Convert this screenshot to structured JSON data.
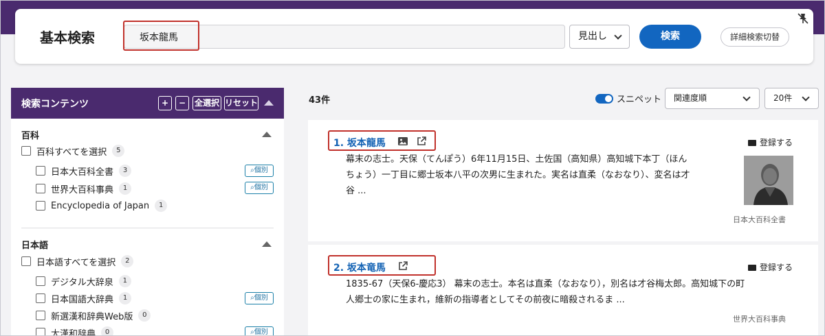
{
  "search": {
    "title": "基本検索",
    "query": "坂本龍馬",
    "scope": "見出し",
    "submit_label": "検索",
    "advanced_label": "詳細検索切替"
  },
  "sidebar": {
    "title": "検索コンテンツ",
    "buttons": {
      "expand": "+",
      "collapse": "−",
      "select_all": "全選択",
      "reset": "リセット"
    },
    "sections": [
      {
        "title": "百科",
        "select_all_label": "百科すべてを選択",
        "select_all_count": "5",
        "items": [
          {
            "label": "日本大百科全書",
            "count": "3",
            "kobetsu": "個別"
          },
          {
            "label": "世界大百科事典",
            "count": "1",
            "kobetsu": "個別"
          },
          {
            "label": "Encyclopedia of Japan",
            "count": "1"
          }
        ]
      },
      {
        "title": "日本語",
        "select_all_label": "日本語すべてを選択",
        "select_all_count": "2",
        "items": [
          {
            "label": "デジタル大辞泉",
            "count": "1"
          },
          {
            "label": "日本国語大辞典",
            "count": "1",
            "kobetsu": "個別"
          },
          {
            "label": "新選漢和辞典Web版",
            "count": "0"
          },
          {
            "label": "大漢和辞典",
            "count": "0",
            "kobetsu": "個別"
          }
        ]
      }
    ]
  },
  "results": {
    "count": "43件",
    "snippet_label": "スニペット",
    "sort": "関連度順",
    "per_page": "20件",
    "register_label": "登録する",
    "items": [
      {
        "title": "1. 坂本龍馬",
        "snippet_lines": [
          "幕末の志士。天保（てんぽう）6年11月15日、土佐国（高知県）高知城下本丁（ほん",
          "ちょう）一丁目に郷士坂本八平の次男に生まれた。実名は直柔（なおなり）、変名は才",
          "谷 ..."
        ],
        "source": "日本大百科全書"
      },
      {
        "title": "2. 坂本竜馬",
        "snippet_lines": [
          "1835-67（天保6-慶応3） 幕末の志士。本名は直柔（なおなり），別名は才谷梅太郎。高知城下の町",
          "人郷士の家に生まれ，維新の指導者としてその前夜に暗殺されるま ..."
        ],
        "source": "世界大百科事典"
      }
    ]
  },
  "colors": {
    "brand_purple": "#4a2a6e",
    "primary_blue": "#1266c0",
    "link_blue": "#1262b4",
    "highlight_red": "#c0302a"
  },
  "icons": [
    "pin-off-icon",
    "chevron-down-icon",
    "image-icon",
    "external-link-icon",
    "folder-plus-icon",
    "collapse-triangle-icon",
    "search-detail-icon"
  ]
}
